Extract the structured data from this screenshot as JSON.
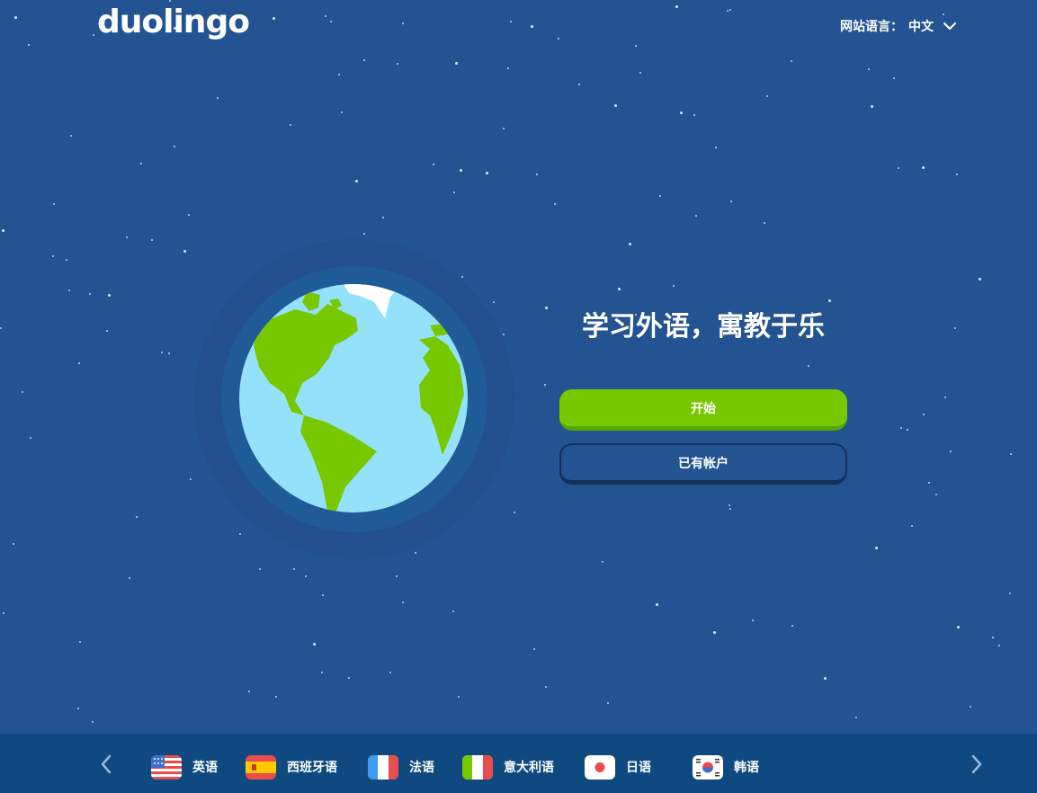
{
  "header": {
    "logo_text": "duolingo",
    "site_language_label": "网站语言：",
    "site_language_value": "中文"
  },
  "hero": {
    "headline": "学习外语，寓教于乐",
    "start_button": "开始",
    "login_button": "已有帐户"
  },
  "language_bar": {
    "items": [
      {
        "label": "英语",
        "flag": "us-flag-icon"
      },
      {
        "label": "西班牙语",
        "flag": "spain-flag-icon"
      },
      {
        "label": "法语",
        "flag": "france-flag-icon"
      },
      {
        "label": "意大利语",
        "flag": "italy-flag-icon"
      },
      {
        "label": "日语",
        "flag": "japan-flag-icon"
      },
      {
        "label": "韩语",
        "flag": "korea-flag-icon"
      }
    ]
  },
  "colors": {
    "background": "#235390",
    "bar": "#0e4a80",
    "accent_green": "#78c800",
    "ocean": "#94e1fc",
    "land": "#78c800"
  }
}
